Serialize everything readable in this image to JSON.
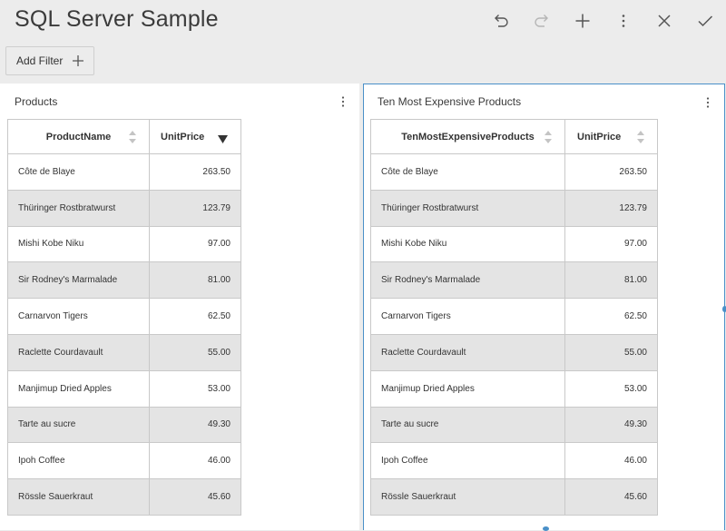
{
  "header": {
    "title": "SQL Server Sample"
  },
  "toolbar": {
    "undo_icon": "undo-icon",
    "redo_icon": "redo-icon",
    "add_icon": "plus-icon",
    "more_icon": "more-vertical-icon",
    "close_icon": "close-icon",
    "confirm_icon": "check-icon"
  },
  "filter": {
    "label": "Add Filter"
  },
  "colors": {
    "accent": "#4a90c8",
    "row_alt": "#e4e4e4",
    "background": "#ececec"
  },
  "panels": {
    "left": {
      "title": "Products",
      "columns": [
        "ProductName",
        "UnitPrice"
      ],
      "sort": "UnitPrice descending",
      "rows": [
        [
          "Côte de Blaye",
          "263.50"
        ],
        [
          "Thüringer Rostbratwurst",
          "123.79"
        ],
        [
          "Mishi Kobe Niku",
          "97.00"
        ],
        [
          "Sir Rodney's Marmalade",
          "81.00"
        ],
        [
          "Carnarvon Tigers",
          "62.50"
        ],
        [
          "Raclette Courdavault",
          "55.00"
        ],
        [
          "Manjimup Dried Apples",
          "53.00"
        ],
        [
          "Tarte au sucre",
          "49.30"
        ],
        [
          "Ipoh Coffee",
          "46.00"
        ],
        [
          "Rössle Sauerkraut",
          "45.60"
        ]
      ]
    },
    "right": {
      "title": "Ten Most Expensive Products",
      "columns": [
        "TenMostExpensiveProducts",
        "UnitPrice"
      ],
      "rows": [
        [
          "Côte de Blaye",
          "263.50"
        ],
        [
          "Thüringer Rostbratwurst",
          "123.79"
        ],
        [
          "Mishi Kobe Niku",
          "97.00"
        ],
        [
          "Sir Rodney's Marmalade",
          "81.00"
        ],
        [
          "Carnarvon Tigers",
          "62.50"
        ],
        [
          "Raclette Courdavault",
          "55.00"
        ],
        [
          "Manjimup Dried Apples",
          "53.00"
        ],
        [
          "Tarte au sucre",
          "49.30"
        ],
        [
          "Ipoh Coffee",
          "46.00"
        ],
        [
          "Rössle Sauerkraut",
          "45.60"
        ]
      ]
    }
  }
}
